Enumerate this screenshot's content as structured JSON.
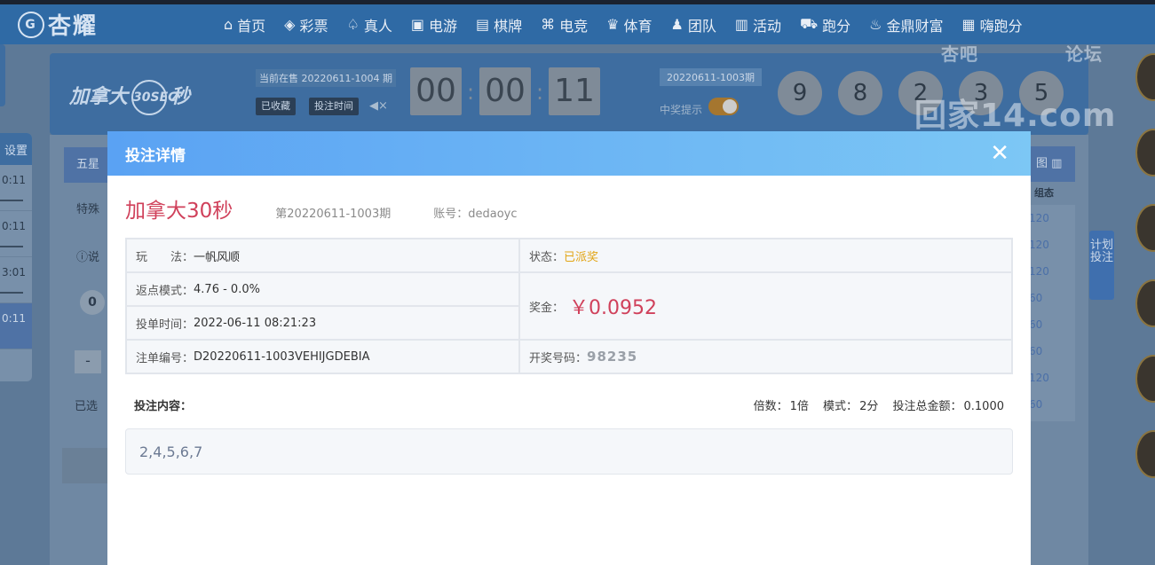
{
  "colors": {
    "modal_header_start": "#5aa2f3",
    "modal_header_end": "#7cc7f5",
    "accent_red": "#d0415b",
    "status_yellow": "#e2a516",
    "nav_blue": "#2f6aa5"
  },
  "brand": {
    "logo_text": "杏耀"
  },
  "nav": [
    {
      "label": "首页",
      "icon": "home-icon"
    },
    {
      "label": "彩票",
      "icon": "lottery-ticket-icon"
    },
    {
      "label": "真人",
      "icon": "live-dealer-icon"
    },
    {
      "label": "电游",
      "icon": "slot-machine-icon"
    },
    {
      "label": "棋牌",
      "icon": "card-game-icon"
    },
    {
      "label": "电竞",
      "icon": "gamepad-icon"
    },
    {
      "label": "体育",
      "icon": "trophy-icon"
    },
    {
      "label": "团队",
      "icon": "team-icon"
    },
    {
      "label": "活动",
      "icon": "gift-icon"
    },
    {
      "label": "跑分",
      "icon": "car-icon"
    },
    {
      "label": "金鼎财富",
      "icon": "cauldron-icon"
    },
    {
      "label": "嗨跑分",
      "icon": "hi-icon"
    }
  ],
  "game": {
    "title_left": "加拿大",
    "title_badge": "30SEC",
    "title_right": "秒",
    "current_issue": "当前在售 20220611-1004 期",
    "favorited_label": "已收藏",
    "bet_time_label": "投注时间",
    "countdown": [
      "00",
      "00",
      "11"
    ],
    "last_issue": "20220611-1003期",
    "win_hint_label": "中奖提示",
    "last_numbers": [
      "9",
      "8",
      "2",
      "3",
      "5"
    ]
  },
  "background": {
    "left_header": "设置",
    "left_times": [
      "0:11",
      "0:11",
      "3:01",
      "0:11"
    ],
    "tab_label": "五星",
    "special_label": "特殊",
    "info_label": "说",
    "zero_ball": "0",
    "minus_label": "-",
    "selected_label": "已选",
    "right_header": "图",
    "right_sub": "组态",
    "right_values": [
      "120",
      "120",
      "120",
      "60",
      "60",
      "60",
      "120",
      "60"
    ],
    "plan_bet_label": "计划投注",
    "watermark": "回家14.com",
    "watermark_top_left": "杏吧",
    "watermark_top_right": "论坛"
  },
  "modal": {
    "title": "投注详情",
    "close_label": "✕",
    "lottery_name": "加拿大30秒",
    "issue": "第20220611-1003期",
    "account_label": "账号：",
    "account_value": "dedaoyc",
    "play_label": "玩　　法：",
    "play_value": "一帆风顺",
    "status_label": "状态：",
    "status_value": "已派奖",
    "rebate_label": "返点模式：",
    "rebate_value": "4.76 - 0.0%",
    "prize_label": "奖金：",
    "prize_value": "￥0.0952",
    "time_label": "投单时间：",
    "time_value": "2022-06-11 08:21:23",
    "order_label": "注单编号：",
    "order_value": "D20220611-1003VEHIJGDEBIA",
    "draw_label": "开奖号码：",
    "draw_value": "98235",
    "content_label": "投注内容：",
    "multiplier_label": "倍数：",
    "multiplier_value": "1倍",
    "mode_label": "模式：",
    "mode_value": "2分",
    "total_label": "投注总金额：",
    "total_value": "0.1000",
    "content_value": "2,4,5,6,7"
  }
}
